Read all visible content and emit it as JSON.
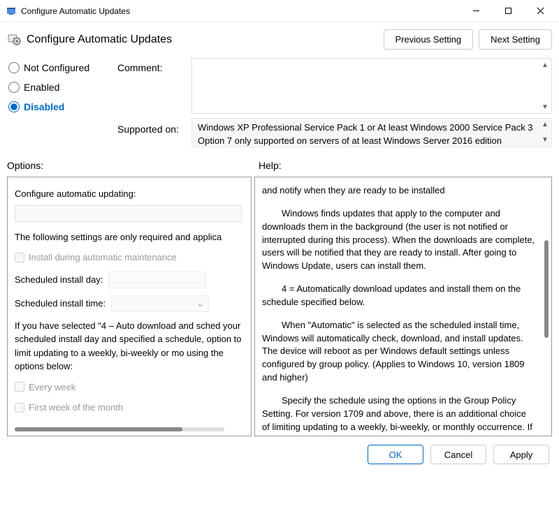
{
  "window": {
    "title": "Configure Automatic Updates"
  },
  "header": {
    "policy_title": "Configure Automatic Updates",
    "prev_btn": "Previous Setting",
    "next_btn": "Next Setting"
  },
  "state": {
    "radios": {
      "not_configured": "Not Configured",
      "enabled": "Enabled",
      "disabled": "Disabled",
      "selected": "disabled"
    },
    "labels": {
      "comment": "Comment:",
      "supported": "Supported on:"
    },
    "supported_text": "Windows XP Professional Service Pack 1 or At least Windows 2000 Service Pack 3 Option 7 only supported on servers of at least Windows Server 2016 edition"
  },
  "sections": {
    "options": "Options:",
    "help": "Help:"
  },
  "options": {
    "configure_label": "Configure automatic updating:",
    "note": "The following settings are only required and applica",
    "chk_install_maint": "Install during automatic maintenance",
    "sched_day": "Scheduled install day:",
    "sched_time": "Scheduled install time:",
    "paragraph": "If you have selected \"4 – Auto download and sched your scheduled install day and specified a schedule, option to limit updating to a weekly, bi-weekly or mo using the options below:",
    "chk_every_week": "Every week",
    "chk_first_week": "First week of the month"
  },
  "help": {
    "p1": "and notify when they are ready to be installed",
    "p2": "Windows finds updates that apply to the computer and downloads them in the background (the user is not notified or interrupted during this process). When the downloads are complete, users will be notified that they are ready to install. After going to Windows Update, users can install them.",
    "p3": "4 = Automatically download updates and install them on the schedule specified below.",
    "p4": "When \"Automatic\" is selected as the scheduled install time, Windows will automatically check, download, and install updates. The device will reboot as per Windows default settings unless configured by group policy. (Applies to Windows 10, version 1809 and higher)",
    "p5": "Specify the schedule using the options in the Group Policy Setting. For version 1709 and above, there is an additional choice of limiting updating to a weekly, bi-weekly, or monthly occurrence. If no schedule is specified, the default schedule for"
  },
  "footer": {
    "ok": "OK",
    "cancel": "Cancel",
    "apply": "Apply"
  }
}
